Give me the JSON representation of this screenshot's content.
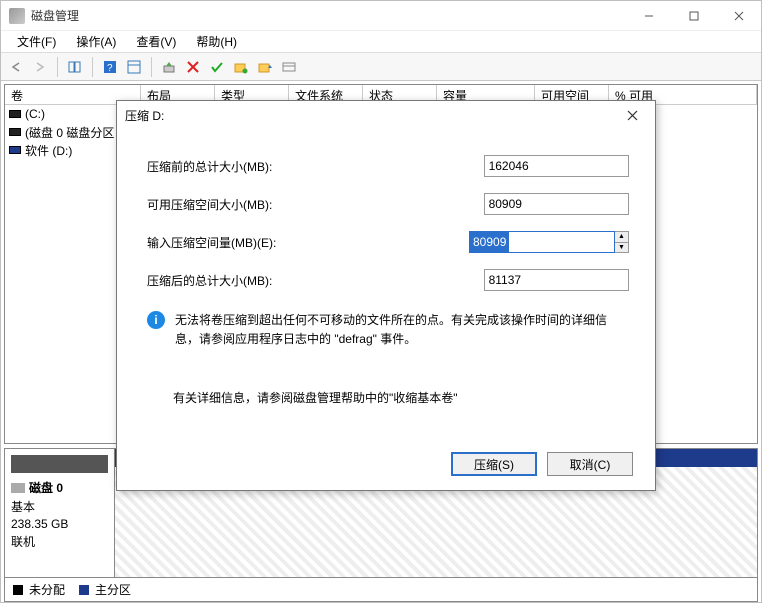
{
  "app": {
    "title": "磁盘管理"
  },
  "menu": {
    "file": "文件(F)",
    "action": "操作(A)",
    "view": "查看(V)",
    "help": "帮助(H)"
  },
  "columns": {
    "volume": "卷",
    "layout": "布局",
    "type": "类型",
    "filesystem": "文件系统",
    "status": "状态",
    "capacity": "容量",
    "free": "可用空间",
    "pctfree": "% 可用"
  },
  "volumes": [
    {
      "label": "(C:)"
    },
    {
      "label": "(磁盘 0 磁盘分区"
    },
    {
      "label": "软件 (D:)"
    }
  ],
  "disk": {
    "header_name": "磁盘 0",
    "basic": "基本",
    "size": "238.35 GB",
    "status": "联机"
  },
  "legend": {
    "unalloc": "未分配",
    "primary": "主分区"
  },
  "dialog": {
    "title": "压缩 D:",
    "row1_label": "压缩前的总计大小(MB):",
    "row1_value": "162046",
    "row2_label": "可用压缩空间大小(MB):",
    "row2_value": "80909",
    "row3_label": "输入压缩空间量(MB)(E):",
    "row3_value": "80909",
    "row4_label": "压缩后的总计大小(MB):",
    "row4_value": "81137",
    "info_line": "无法将卷压缩到超出任何不可移动的文件所在的点。有关完成该操作时间的详细信息，请参阅应用程序日志中的 \"defrag\" 事件。",
    "help": "有关详细信息，请参阅磁盘管理帮助中的\"收缩基本卷\"",
    "btn_shrink": "压缩(S)",
    "btn_cancel": "取消(C)"
  }
}
